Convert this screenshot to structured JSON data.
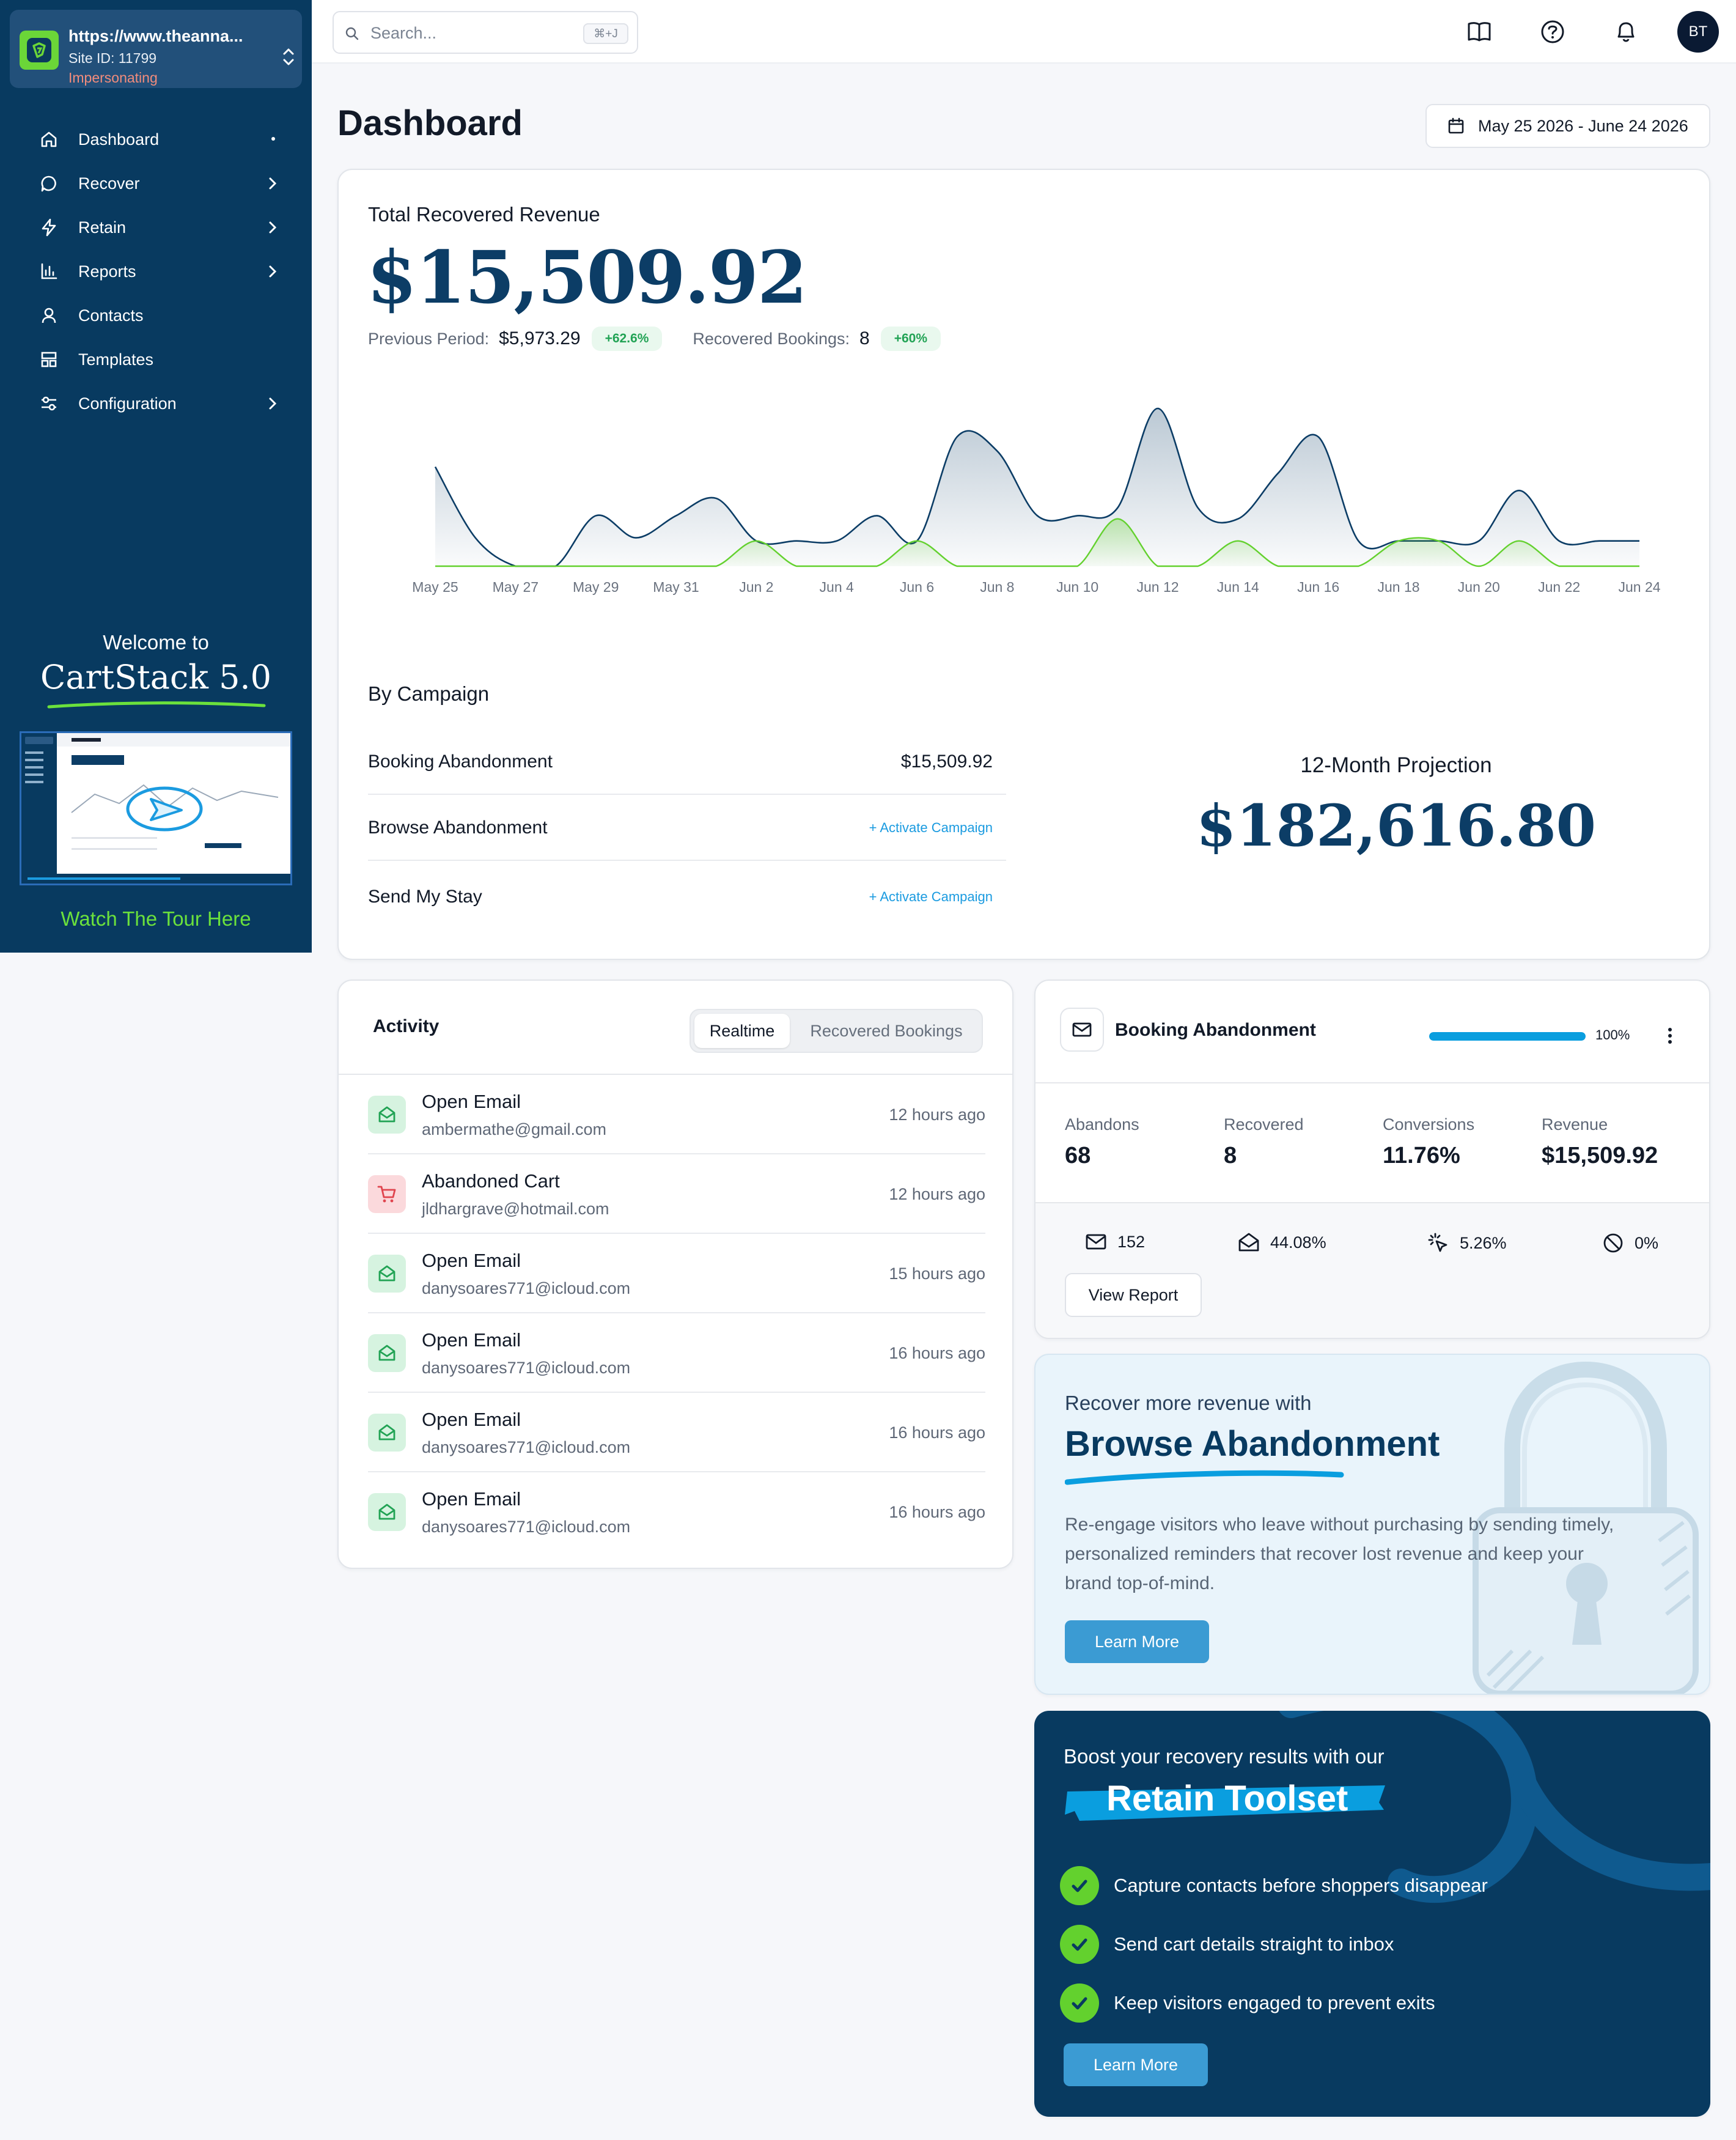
{
  "site": {
    "url": "https://www.theanna...",
    "id": "Site ID: 11799",
    "status": "Impersonating"
  },
  "nav": [
    {
      "label": "Dashboard",
      "icon": "home-icon"
    },
    {
      "label": "Recover",
      "icon": "chat-icon"
    },
    {
      "label": "Retain",
      "icon": "bolt-icon"
    },
    {
      "label": "Reports",
      "icon": "bar-chart-icon"
    },
    {
      "label": "Contacts",
      "icon": "user-icon"
    },
    {
      "label": "Templates",
      "icon": "layout-icon"
    },
    {
      "label": "Configuration",
      "icon": "sliders-icon"
    }
  ],
  "tour": {
    "welcome": "Welcome to",
    "brand": "CartStack 5.0",
    "link": "Watch The Tour Here"
  },
  "topbar": {
    "search_placeholder": "Search...",
    "shortcut": "⌘+J",
    "avatar": "BT"
  },
  "page": {
    "title": "Dashboard",
    "date_range": "May 25 2026 - June 24 2026"
  },
  "revenue": {
    "label": "Total Recovered Revenue",
    "value": "$15,509.92",
    "prev_label": "Previous Period:",
    "prev_value": "$5,973.29",
    "prev_change": "+62.6%",
    "bookings_label": "Recovered Bookings:",
    "bookings_value": "8",
    "bookings_change": "+60%"
  },
  "chart_data": {
    "type": "area",
    "x": [
      "May 25",
      "May 26",
      "May 27",
      "May 28",
      "May 29",
      "May 30",
      "May 31",
      "Jun 1",
      "Jun 2",
      "Jun 3",
      "Jun 4",
      "Jun 5",
      "Jun 6",
      "Jun 7",
      "Jun 8",
      "Jun 9",
      "Jun 10",
      "Jun 11",
      "Jun 12",
      "Jun 13",
      "Jun 14",
      "Jun 15",
      "Jun 16",
      "Jun 17",
      "Jun 18",
      "Jun 19",
      "Jun 20",
      "Jun 21",
      "Jun 22",
      "Jun 23",
      "Jun 24"
    ],
    "tick_labels": [
      "May 25",
      "May 27",
      "May 29",
      "May 31",
      "Jun 2",
      "Jun 4",
      "Jun 6",
      "Jun 8",
      "Jun 10",
      "Jun 12",
      "Jun 14",
      "Jun 16",
      "Jun 18",
      "Jun 20",
      "Jun 22",
      "Jun 24"
    ],
    "series": [
      {
        "values": [
          0.63,
          0.18,
          0,
          0,
          0.32,
          0.18,
          0.32,
          0.43,
          0.16,
          0.16,
          0.16,
          0.32,
          0.16,
          0.82,
          0.73,
          0.32,
          0.32,
          0.37,
          1.0,
          0.37,
          0.3,
          0.59,
          0.82,
          0.16,
          0.16,
          0.16,
          0.16,
          0.48,
          0.16,
          0.16,
          0.16
        ],
        "color": "#0c3d66"
      },
      {
        "values": [
          0,
          0,
          0,
          0,
          0,
          0,
          0,
          0,
          0.16,
          0,
          0,
          0,
          0.16,
          0,
          0,
          0,
          0,
          0.3,
          0,
          0,
          0.16,
          0,
          0,
          0,
          0.16,
          0.16,
          0,
          0.16,
          0,
          0,
          0
        ],
        "color": "#63d12e"
      }
    ],
    "grid": false,
    "legend": "none"
  },
  "campaigns": {
    "heading": "By Campaign",
    "rows": [
      {
        "name": "Booking Abandonment",
        "value": "$15,509.92"
      },
      {
        "name": "Browse Abandonment",
        "action": "+ Activate Campaign"
      },
      {
        "name": "Send My Stay",
        "action": "+ Activate Campaign"
      }
    ],
    "projection_label": "12-Month Projection",
    "projection_value": "$182,616.80"
  },
  "activity": {
    "title": "Activity",
    "tabs": [
      "Realtime",
      "Recovered Bookings"
    ],
    "items": [
      {
        "type": "Open Email",
        "email": "ambermathe@gmail.com",
        "time": "12 hours ago",
        "icon": "mail-open-icon"
      },
      {
        "type": "Abandoned Cart",
        "email": "jldhargrave@hotmail.com",
        "time": "12 hours ago",
        "icon": "cart-icon"
      },
      {
        "type": "Open Email",
        "email": "danysoares771@icloud.com",
        "time": "15 hours ago",
        "icon": "mail-open-icon"
      },
      {
        "type": "Open Email",
        "email": "danysoares771@icloud.com",
        "time": "16 hours ago",
        "icon": "mail-open-icon"
      },
      {
        "type": "Open Email",
        "email": "danysoares771@icloud.com",
        "time": "16 hours ago",
        "icon": "mail-open-icon"
      },
      {
        "type": "Open Email",
        "email": "danysoares771@icloud.com",
        "time": "16 hours ago",
        "icon": "mail-open-icon"
      }
    ]
  },
  "booking": {
    "title": "Booking Abandonment",
    "progress": 1.0,
    "progress_label": "100%",
    "stats": [
      {
        "label": "Abandons",
        "value": "68"
      },
      {
        "label": "Recovered",
        "value": "8"
      },
      {
        "label": "Conversions",
        "value": "11.76%"
      },
      {
        "label": "Revenue",
        "value": "$15,509.92"
      }
    ],
    "mini": [
      {
        "icon": "mail-icon",
        "value": "152"
      },
      {
        "icon": "mail-open-icon",
        "value": "44.08%"
      },
      {
        "icon": "click-icon",
        "value": "5.26%"
      },
      {
        "icon": "block-icon",
        "value": "0%"
      }
    ],
    "report_button": "View Report"
  },
  "promo_browse": {
    "subtitle": "Recover more revenue with",
    "title": "Browse Abandonment",
    "body": "Re-engage visitors who leave without purchasing by sending timely, personalized reminders that recover lost revenue and keep your brand top-of-mind.",
    "button": "Learn More"
  },
  "promo_retain": {
    "subtitle": "Boost your recovery results with our",
    "title": "Retain Toolset",
    "items": [
      "Capture contacts before shoppers disappear",
      "Send cart details straight to inbox",
      "Keep visitors engaged to prevent exits"
    ],
    "button": "Learn More"
  },
  "colors": {
    "navy": "#083a60",
    "accent_green": "#63d12e",
    "accent_blue": "#0a9edf",
    "revenue_blue": "#0c3d66"
  }
}
